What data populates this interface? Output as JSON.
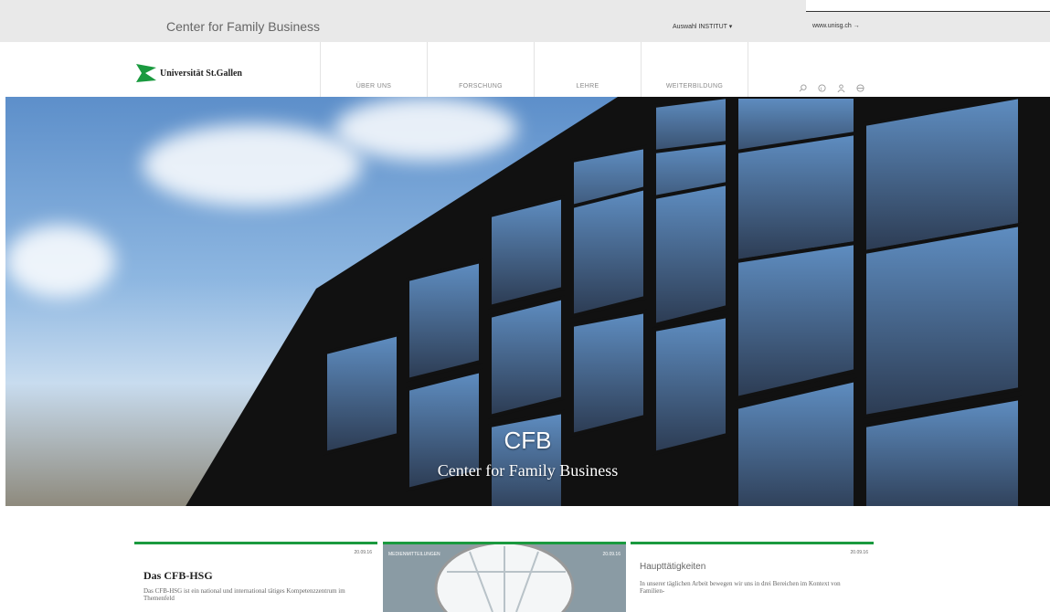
{
  "topbar": {
    "site_title": "Center for Family Business",
    "institute_dropdown": "Auswahl INSTITUT ▾",
    "external_link": "www.unisg.ch →"
  },
  "logo": {
    "text": "Universität St.Gallen",
    "color": "#1a9a3f"
  },
  "menu": [
    {
      "label": "ÜBER UNS"
    },
    {
      "label": "FORSCHUNG"
    },
    {
      "label": "LEHRE"
    },
    {
      "label": "WEITERBILDUNG"
    }
  ],
  "tools": [
    "search-icon",
    "translate-icon",
    "user-icon",
    "globe-icon"
  ],
  "hero": {
    "title": "CFB",
    "subtitle": "Center for Family Business"
  },
  "cards": [
    {
      "date": "20.09.16",
      "heading": "Das CFB-HSG",
      "body": "Das CFB-HSG ist ein national und international tätiges Kompetenzzentrum im Themenfeld"
    },
    {
      "label": "MEDIENMITTEILUNGEN",
      "date": "20.09.16"
    },
    {
      "date": "20.09.16",
      "heading": "Haupttätigkeiten",
      "body": "In unserer täglichen Arbeit bewegen wir uns in drei Bereichen im Kontext von Familien-"
    }
  ],
  "colors": {
    "accent": "#1a9a3f",
    "topbar": "#e9e9e9"
  }
}
